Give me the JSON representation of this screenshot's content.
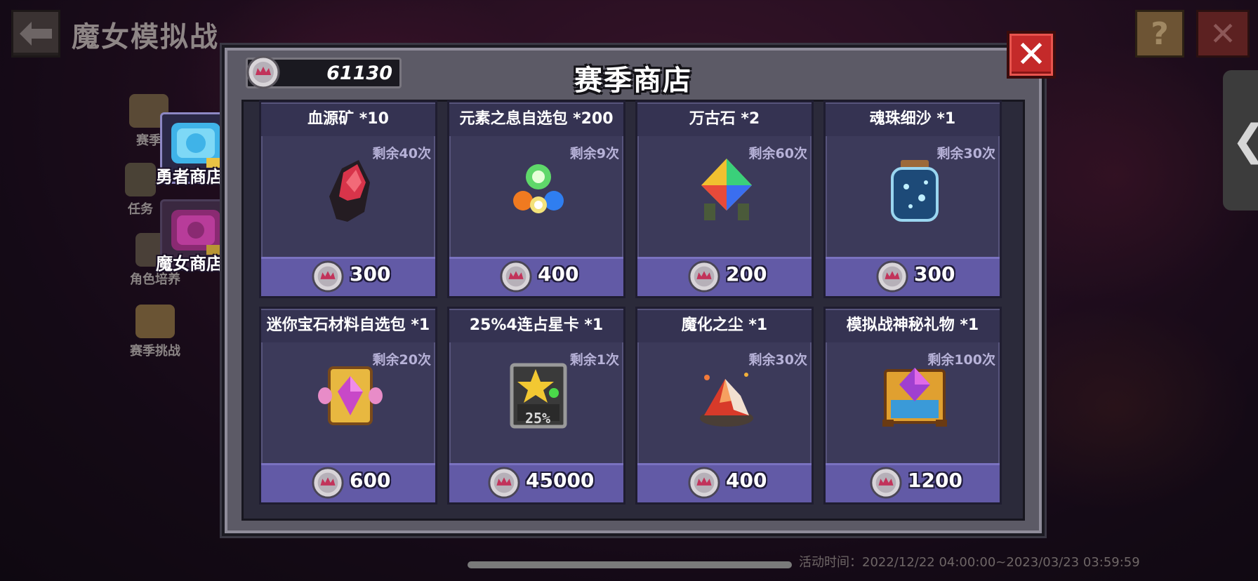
{
  "header": {
    "page_title": "魔女模拟战",
    "back_icon": "back-arrow-icon",
    "help_label": "?",
    "close_label": "✕"
  },
  "sidebar": {
    "items": [
      {
        "label": "赛季"
      },
      {
        "label": "任务"
      },
      {
        "label": "角色培养"
      },
      {
        "label": "赛季挑战"
      }
    ],
    "shop_tabs": [
      {
        "label": "勇者商店",
        "color": "#3fb3e8"
      },
      {
        "label": "魔女商店",
        "color": "#b83c9a"
      }
    ]
  },
  "dialog": {
    "title": "赛季商店",
    "currency": {
      "value": "61130",
      "icon": "season-coin-icon"
    },
    "close_label": "✕",
    "items": [
      {
        "name": "血源矿 *10",
        "remain": "剩余40次",
        "price": "300",
        "icon": "blood-ore-icon"
      },
      {
        "name": "元素之息自选包 *200",
        "remain": "剩余9次",
        "price": "400",
        "icon": "element-breath-icon"
      },
      {
        "name": "万古石 *2",
        "remain": "剩余60次",
        "price": "200",
        "icon": "ancient-stone-icon"
      },
      {
        "name": "魂珠细沙 *1",
        "remain": "剩余30次",
        "price": "300",
        "icon": "soul-sand-jar-icon"
      },
      {
        "name": "迷你宝石材料自选包 *1",
        "remain": "剩余20次",
        "price": "600",
        "icon": "gem-material-pack-icon"
      },
      {
        "name": "25%4连占星卡 *1",
        "remain": "剩余1次",
        "price": "45000",
        "icon": "star-card-icon"
      },
      {
        "name": "魔化之尘 *1",
        "remain": "剩余30次",
        "price": "400",
        "icon": "demon-dust-icon"
      },
      {
        "name": "模拟战神秘礼物 *1",
        "remain": "剩余100次",
        "price": "1200",
        "icon": "mystery-gift-chest-icon"
      }
    ],
    "star_card_badge": "25%"
  },
  "footer": {
    "event_time": "活动时间：2022/12/22 04:00:00~2023/03/23 03:59:59"
  }
}
